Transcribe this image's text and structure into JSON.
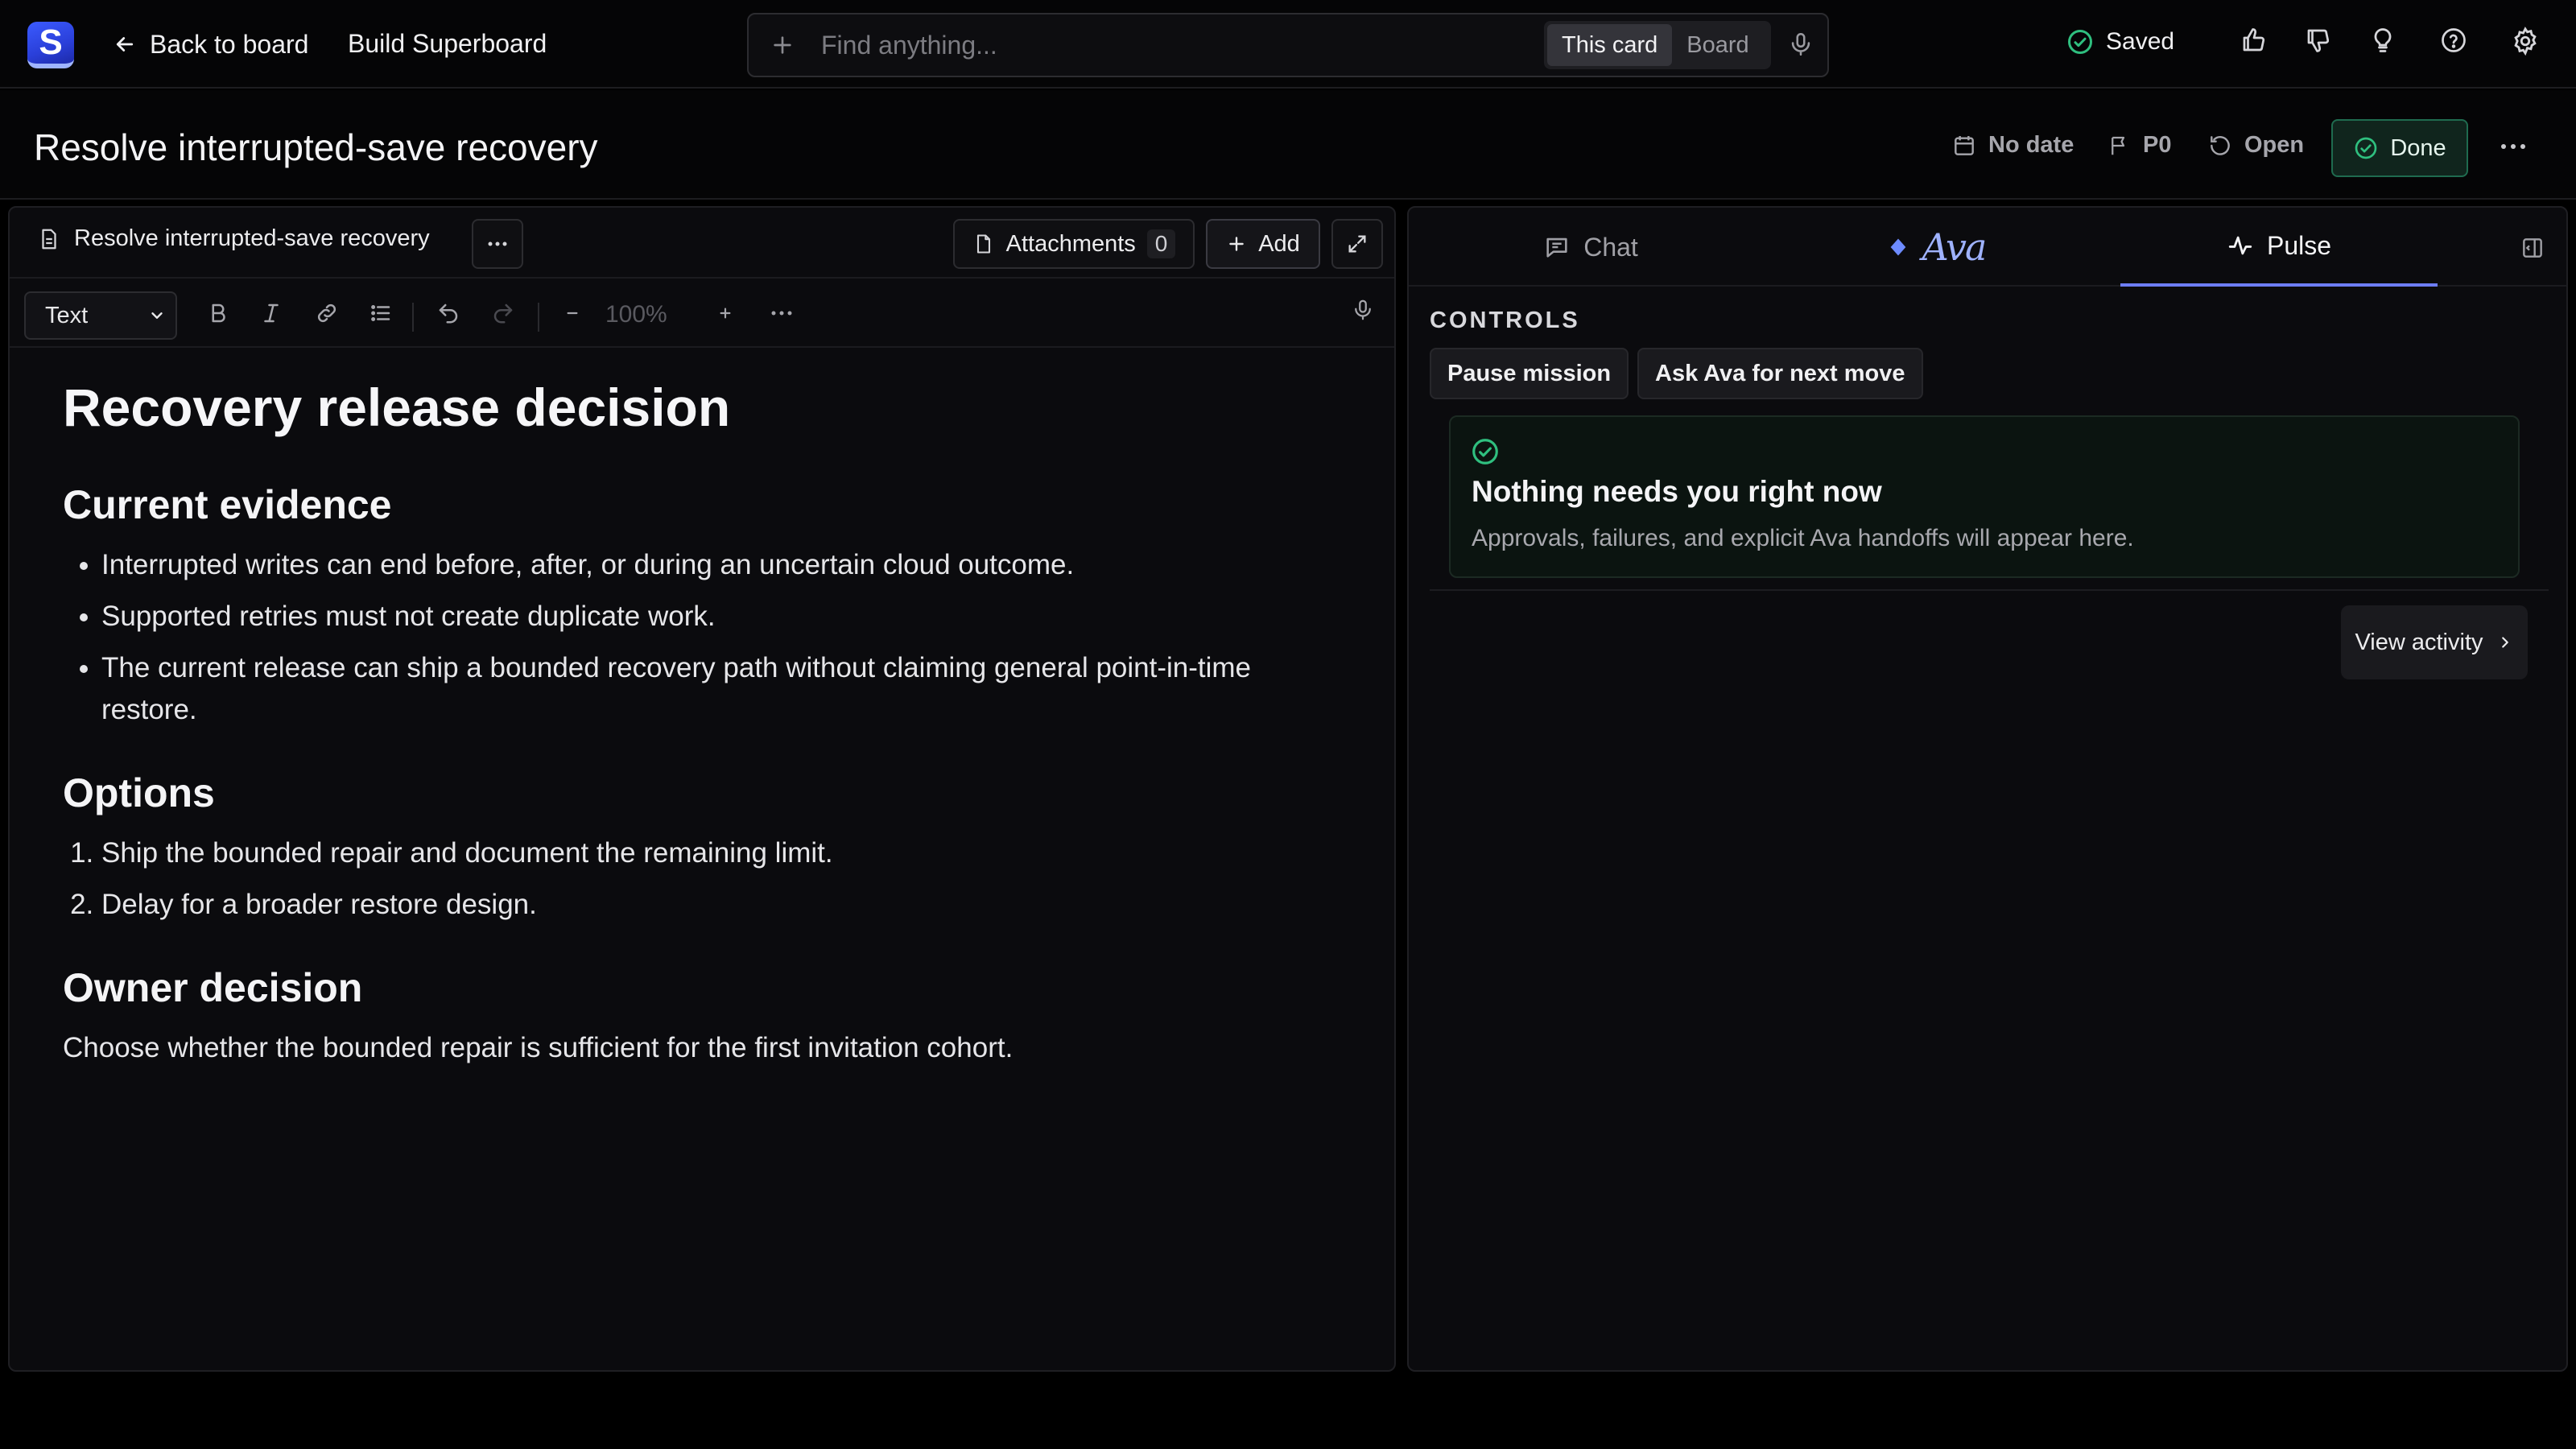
{
  "app": {
    "logo_letter": "S",
    "back_label": "Back to board",
    "board_name": "Build Superboard"
  },
  "search": {
    "placeholder": "Find anything...",
    "scope_options": [
      "This card",
      "Board"
    ],
    "active_scope": "This card"
  },
  "status": {
    "saved_label": "Saved"
  },
  "card": {
    "title": "Resolve interrupted-save recovery",
    "date_label": "No date",
    "priority_label": "P0",
    "state_label": "Open",
    "done_label": "Done"
  },
  "editor": {
    "doc_tab_label": "Resolve interrupted-save recovery",
    "attachments_label": "Attachments",
    "attachments_count": "0",
    "add_label": "Add",
    "block_style": "Text",
    "zoom": "100%",
    "doc": {
      "h1": "Recovery release decision",
      "section1_heading": "Current evidence",
      "evidence": [
        "Interrupted writes can end before, after, or during an uncertain cloud outcome.",
        "Supported retries must not create duplicate work.",
        "The current release can ship a bounded recovery path without claiming general point-in-time restore."
      ],
      "section2_heading": "Options",
      "options": [
        "Ship the bounded repair and document the remaining limit.",
        "Delay for a broader restore design."
      ],
      "section3_heading": "Owner decision",
      "decision": "Choose whether the bounded repair is sufficient for the first invitation cohort."
    }
  },
  "side": {
    "tabs": {
      "chat": "Chat",
      "ava": "Ava",
      "pulse": "Pulse"
    },
    "active_tab": "Pulse",
    "controls_label": "CONTROLS",
    "pause_label": "Pause mission",
    "ask_label": "Ask Ava for next move",
    "status_headline": "Nothing needs you right now",
    "status_desc": "Approvals, failures, and explicit Ava handoffs will appear here.",
    "view_activity_label": "View activity"
  },
  "colors": {
    "accent": "#6d7df6",
    "success": "#2fbf7f",
    "background": "#000000",
    "panel": "#0b0b0e"
  }
}
